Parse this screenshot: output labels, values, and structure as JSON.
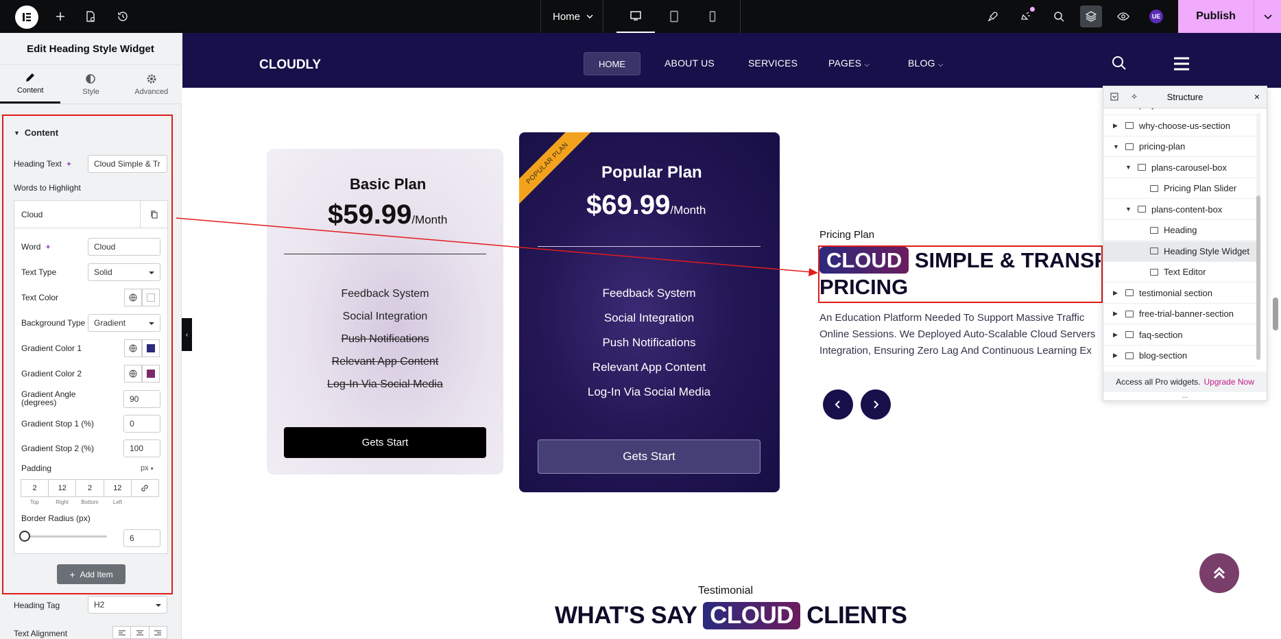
{
  "topbar": {
    "page_name": "Home",
    "publish_label": "Publish",
    "user_initials": "UE"
  },
  "panel": {
    "title": "Edit Heading Style Widget",
    "tabs": [
      {
        "label": "Content",
        "icon": "pencil-icon"
      },
      {
        "label": "Style",
        "icon": "half-circle-icon"
      },
      {
        "label": "Advanced",
        "icon": "gear-icon"
      }
    ],
    "section_title": "Content",
    "heading_text_label": "Heading Text",
    "heading_text_value": "Cloud  Simple & Tr",
    "words_label": "Words to Highlight",
    "repeater_item_title": "Cloud",
    "word_label": "Word",
    "word_value": "Cloud",
    "text_type_label": "Text Type",
    "text_type_value": "Solid",
    "text_color_label": "Text Color",
    "bg_type_label": "Background Type",
    "bg_type_value": "Gradient",
    "grad1_label": "Gradient Color 1",
    "grad1_color": "#2b2a7e",
    "grad2_label": "Gradient Color 2",
    "grad2_color": "#7a2a6a",
    "angle_label": "Gradient Angle (degrees)",
    "angle_value": "90",
    "stop1_label": "Gradient Stop 1 (%)",
    "stop1_value": "0",
    "stop2_label": "Gradient Stop 2 (%)",
    "stop2_value": "100",
    "padding_label": "Padding",
    "padding_unit": "px",
    "padding_values": [
      "2",
      "12",
      "2",
      "12"
    ],
    "padding_sides": [
      "Top",
      "Right",
      "Bottom",
      "Left"
    ],
    "radius_label": "Border Radius (px)",
    "radius_value": "6",
    "add_item_label": "Add Item",
    "heading_tag_label": "Heading Tag",
    "heading_tag_value": "H2",
    "text_align_label": "Text Alignment"
  },
  "site": {
    "brand": "CLOUDLY",
    "nav": [
      "HOME",
      "ABOUT US",
      "SERVICES",
      "PAGES",
      "BLOG"
    ],
    "basic": {
      "title": "Basic Plan",
      "price": "$59.99",
      "period": "/Month",
      "features": [
        "Feedback System",
        "Social Integration",
        "Push Notifications",
        "Relevant App Content",
        "Log-In Via Social Media"
      ],
      "button": "Gets Start"
    },
    "popular": {
      "ribbon": "POPULAR PLAN",
      "title": "Popular Plan",
      "price": "$69.99",
      "period": "/Month",
      "features": [
        "Feedback System",
        "Social Integration",
        "Push Notifications",
        "Relevant App Content",
        "Log-In Via Social Media"
      ],
      "button": "Gets Start"
    },
    "pricing_label": "Pricing Plan",
    "heading_highlight": "CLOUD",
    "heading_rest": "SIMPLE & TRANSP",
    "heading_line2": "PRICING",
    "paragraph": [
      "An Education Platform Needed To Support Massive Traffic",
      "Online Sessions. We Deployed Auto-Scalable Cloud Servers",
      "Integration, Ensuring Zero Lag And Continuous Learning Ex"
    ],
    "testimonial_label": "Testimonial",
    "testimonial_pre": "WHAT'S SAY",
    "testimonial_hl": "CLOUD",
    "testimonial_post": "CLIENTS"
  },
  "structure": {
    "title": "Structure",
    "items": [
      {
        "label": "project-section",
        "level": 0,
        "caret": "right"
      },
      {
        "label": "why-choose-us-section",
        "level": 0,
        "caret": "right"
      },
      {
        "label": "pricing-plan",
        "level": 0,
        "caret": "down"
      },
      {
        "label": "plans-carousel-box",
        "level": 1,
        "caret": "down"
      },
      {
        "label": "Pricing Plan Slider",
        "level": 2,
        "caret": "none"
      },
      {
        "label": "plans-content-box",
        "level": 1,
        "caret": "down"
      },
      {
        "label": "Heading",
        "level": 2,
        "caret": "none"
      },
      {
        "label": "Heading Style Widget",
        "level": 2,
        "caret": "none"
      },
      {
        "label": "Text Editor",
        "level": 2,
        "caret": "none"
      },
      {
        "label": "testimonial section",
        "level": 0,
        "caret": "right"
      },
      {
        "label": "free-trial-banner-section",
        "level": 0,
        "caret": "right"
      },
      {
        "label": "faq-section",
        "level": 0,
        "caret": "right"
      },
      {
        "label": "blog-section",
        "level": 0,
        "caret": "right"
      }
    ],
    "footer_text": "Access all Pro widgets.",
    "footer_link": "Upgrade Now",
    "more": "..."
  }
}
